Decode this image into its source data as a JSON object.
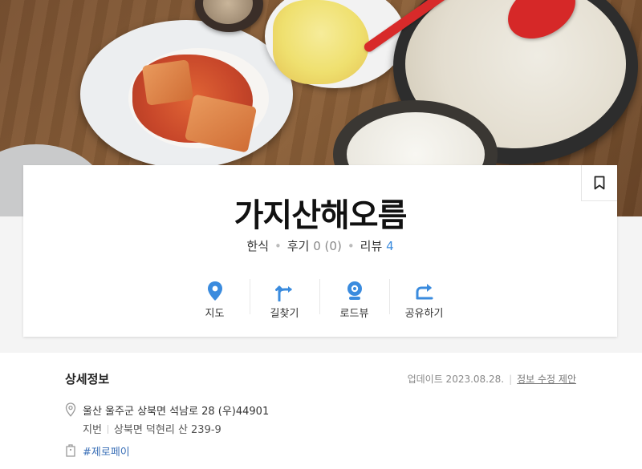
{
  "place": {
    "name": "가지산해오름",
    "category": "한식",
    "reviews_label": "후기",
    "reviews_count": "0 (0)",
    "blog_reviews_label": "리뷰",
    "blog_reviews_count": "4"
  },
  "actions": [
    {
      "label": "지도",
      "icon": "map-pin-icon"
    },
    {
      "label": "길찾기",
      "icon": "directions-icon"
    },
    {
      "label": "로드뷰",
      "icon": "roadview-icon"
    },
    {
      "label": "공유하기",
      "icon": "share-icon"
    }
  ],
  "details": {
    "title": "상세정보",
    "updated": "업데이트 2023.08.28.",
    "suggest_edit": "정보 수정 제안",
    "address": "울산 울주군 상북면 석남로 28 (우)44901",
    "jibun_label": "지번",
    "jibun_address": "상북면 덕현리 산 239-9",
    "tag": "#제로페이"
  },
  "colors": {
    "accent": "#3a8bde",
    "text": "#222222",
    "muted": "#888888",
    "tag": "#3a6fb7"
  }
}
